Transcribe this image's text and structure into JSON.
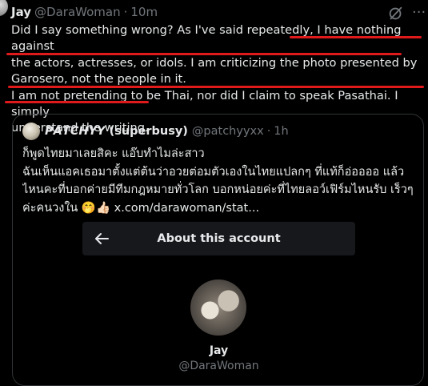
{
  "post": {
    "author_name": "Jay",
    "author_handle": "@DaraWoman",
    "separator": "·",
    "time": "10m",
    "more_glyph": "···",
    "lines": [
      "Did I say something wrong? As I've said repeatedly, I have nothing against",
      "the actors, actresses, or idols. I am criticizing the photo presented by",
      "Garosero, not the people in it.",
      "I am not pretending to be Thai, nor did I claim to speak Pasathai. I simply",
      "understand the writing."
    ],
    "underline_color": "#e0191b"
  },
  "quote": {
    "author_name": "𝙋𝘼𝙏𝘾𝙃𝙔𝙔 (superbusy)",
    "author_handle": "@patchyyxx",
    "separator": "·",
    "time": "1h",
    "lines": [
      "ก็พูดไทยมาเลยสิคะ แอ๊บทำไมล่ะสาว",
      "ฉันเห็นแอคเธอมาตั้งแต่ต้นว่าอวยต่อมตัวเองในไทยแปลกๆ ที่แท้ก็อ่ออออ แล้ว",
      "ไหนคะที่บอกค่ายมีทีมกฎหมายทั่วโลก บอกหน่อยค่ะที่ไทยลอว์เฟิร์มไหนรับ เร็วๆ",
      "ค่ะคนวงใน 🤭👍🏻  x.com/darawoman/stat..."
    ],
    "card": {
      "title": "About this account",
      "profile_name": "Jay",
      "profile_handle": "@DaraWoman"
    }
  }
}
